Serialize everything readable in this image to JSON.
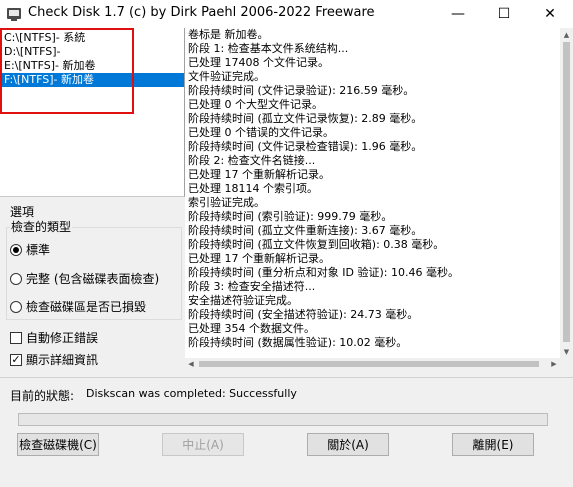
{
  "window": {
    "title": "Check Disk 1.7  (c) by Dirk Paehl  2006-2022 Freeware",
    "minimize": "—",
    "maximize": "☐",
    "close": "✕"
  },
  "drives": [
    {
      "label": "C:\\[NTFS]- 系統",
      "selected": false
    },
    {
      "label": "D:\\[NTFS]-",
      "selected": false
    },
    {
      "label": "E:\\[NTFS]- 新加卷",
      "selected": false
    },
    {
      "label": "F:\\[NTFS]- 新加卷",
      "selected": true
    }
  ],
  "log": [
    "卷标是 新加卷。",
    "阶段 1: 检查基本文件系统结构...",
    "已处理 17408 个文件记录。",
    "文件验证完成。",
    "阶段持续时间 (文件记录验证): 216.59 毫秒。",
    "已处理 0 个大型文件记录。",
    "阶段持续时间 (孤立文件记录恢复): 2.89 毫秒。",
    "已处理 0 个错误的文件记录。",
    "阶段持续时间 (文件记录检查错误): 1.96 毫秒。",
    "阶段 2: 检查文件名链接...",
    "已处理 17 个重新解析记录。",
    "已处理 18114 个索引项。",
    "索引验证完成。",
    "阶段持续时间 (索引验证): 999.79 毫秒。",
    "阶段持续时间 (孤立文件重新连接): 3.67 毫秒。",
    "阶段持续时间 (孤立文件恢复到回收箱): 0.38 毫秒。",
    "已处理 17 个重新解析记录。",
    "阶段持续时间 (重分析点和对象 ID 验证): 10.46 毫秒。",
    "阶段 3: 检查安全描述符...",
    "安全描述符验证完成。",
    "阶段持续时间 (安全描述符验证): 24.73 毫秒。",
    "已处理 354 个数据文件。",
    "阶段持续时间 (数据属性验证): 10.02 毫秒。"
  ],
  "options": {
    "section_label": "選項",
    "group_title": "檢查的類型",
    "radios": [
      {
        "label": "標準",
        "checked": true
      },
      {
        "label": "完整 (包含磁碟表面檢查)",
        "checked": false
      },
      {
        "label": "檢查磁碟區是否已損毀",
        "checked": false
      }
    ],
    "auto_fix": {
      "label": "自動修正錯誤",
      "checked": false
    },
    "show_details": {
      "label": "顯示詳細資訊",
      "checked": true
    }
  },
  "status": {
    "label": "目前的狀態:",
    "text": "Diskscan was completed: Successfully"
  },
  "progress": 0,
  "buttons": {
    "check": "檢查磁碟機(C)",
    "stop": "中止(A)",
    "about": "關於(A)",
    "exit": "離開(E)"
  }
}
